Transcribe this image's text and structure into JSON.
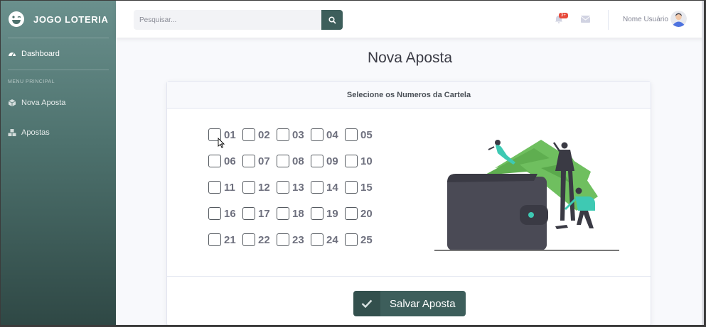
{
  "sidebar": {
    "brand": "JOGO LOTERIA",
    "items": [
      {
        "label": "Dashboard",
        "icon": "dashboard-icon"
      },
      {
        "label": "Nova Aposta",
        "icon": "cube-icon"
      },
      {
        "label": "Apostas",
        "icon": "cubes-icon"
      }
    ],
    "heading": "MENU PRINCIPAL"
  },
  "topbar": {
    "search_placeholder": "Pesquisar...",
    "alert_badge": "3+",
    "user_name": "Nome Usuário"
  },
  "main": {
    "title": "Nova Aposta",
    "card_header": "Selecione os Numeros da Cartela",
    "numbers": [
      "01",
      "02",
      "03",
      "04",
      "05",
      "06",
      "07",
      "08",
      "09",
      "10",
      "11",
      "12",
      "13",
      "14",
      "15",
      "16",
      "17",
      "18",
      "19",
      "20",
      "21",
      "22",
      "23",
      "24",
      "25"
    ],
    "save_label": "Salvar Aposta"
  },
  "colors": {
    "accent": "#3d5e5b",
    "sidebar_top": "#6a908d",
    "sidebar_bottom": "#2f4845",
    "badge": "#e74a3b",
    "money_green": "#6fbf5f"
  }
}
